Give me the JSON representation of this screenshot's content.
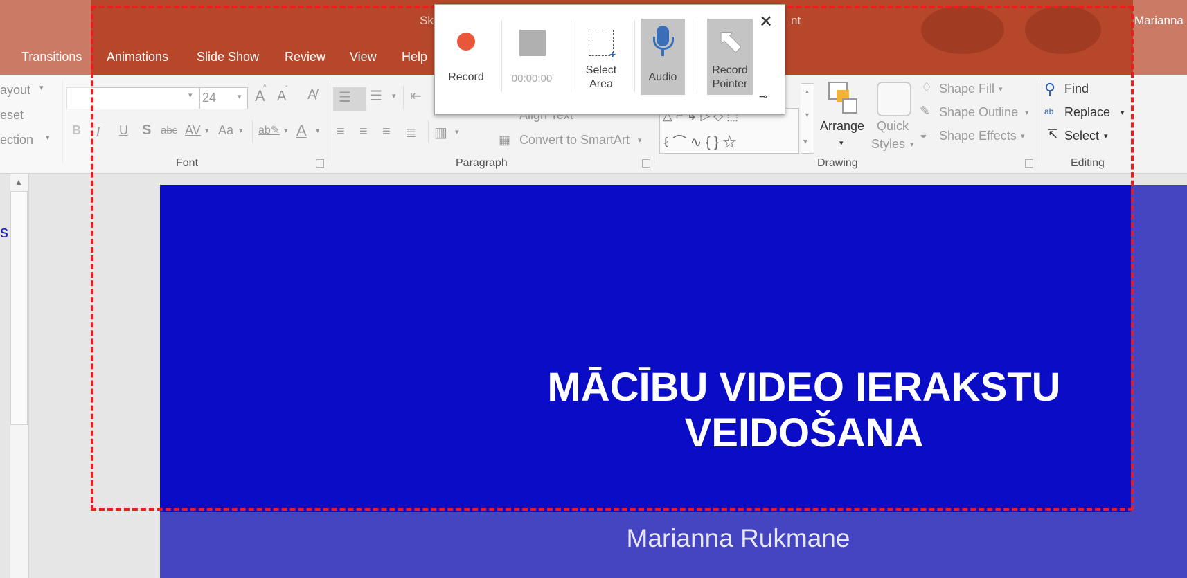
{
  "window": {
    "doc_title_left": "Sk",
    "doc_title_right": "nt",
    "user": "Marianna"
  },
  "tabs": [
    "Transitions",
    "Animations",
    "Slide Show",
    "Review",
    "View",
    "Help"
  ],
  "ribbon": {
    "slides_group": {
      "layout": "ayout",
      "reset": "eset",
      "section": "ection"
    },
    "font": {
      "size": "24",
      "group_label": "Font",
      "bold": "B",
      "italic": "I",
      "underline": "U",
      "shadow": "S",
      "strike": "abc",
      "spacing": "AV",
      "case": "Aa",
      "grow": "A",
      "shrink": "A"
    },
    "paragraph": {
      "align_text": "Align Text",
      "convert_smartart": "Convert to SmartArt",
      "group_label": "Paragraph"
    },
    "drawing": {
      "arrange": "Arrange",
      "quick_styles_1": "Quick",
      "quick_styles_2": "Styles",
      "shape_fill": "Shape Fill",
      "shape_outline": "Shape Outline",
      "shape_effects": "Shape Effects",
      "group_label": "Drawing"
    },
    "editing": {
      "find": "Find",
      "replace": "Replace",
      "select": "Select",
      "group_label": "Editing"
    }
  },
  "recorder": {
    "record": "Record",
    "time": "00:00:00",
    "select_area_1": "Select",
    "select_area_2": "Area",
    "audio": "Audio",
    "record_pointer_1": "Record",
    "record_pointer_2": "Pointer",
    "colors": {
      "record_dot": "#e8573a",
      "frame": "#ee1c1c"
    }
  },
  "slide": {
    "title_line1": "MĀCĪBU VIDEO IERAKSTU",
    "title_line2": "VEIDOŠANA",
    "subtitle": "Marianna Rukmane",
    "colors": {
      "background": "#0b0cc6",
      "dimmed": "#4545c1"
    }
  },
  "left_fragment": "s"
}
